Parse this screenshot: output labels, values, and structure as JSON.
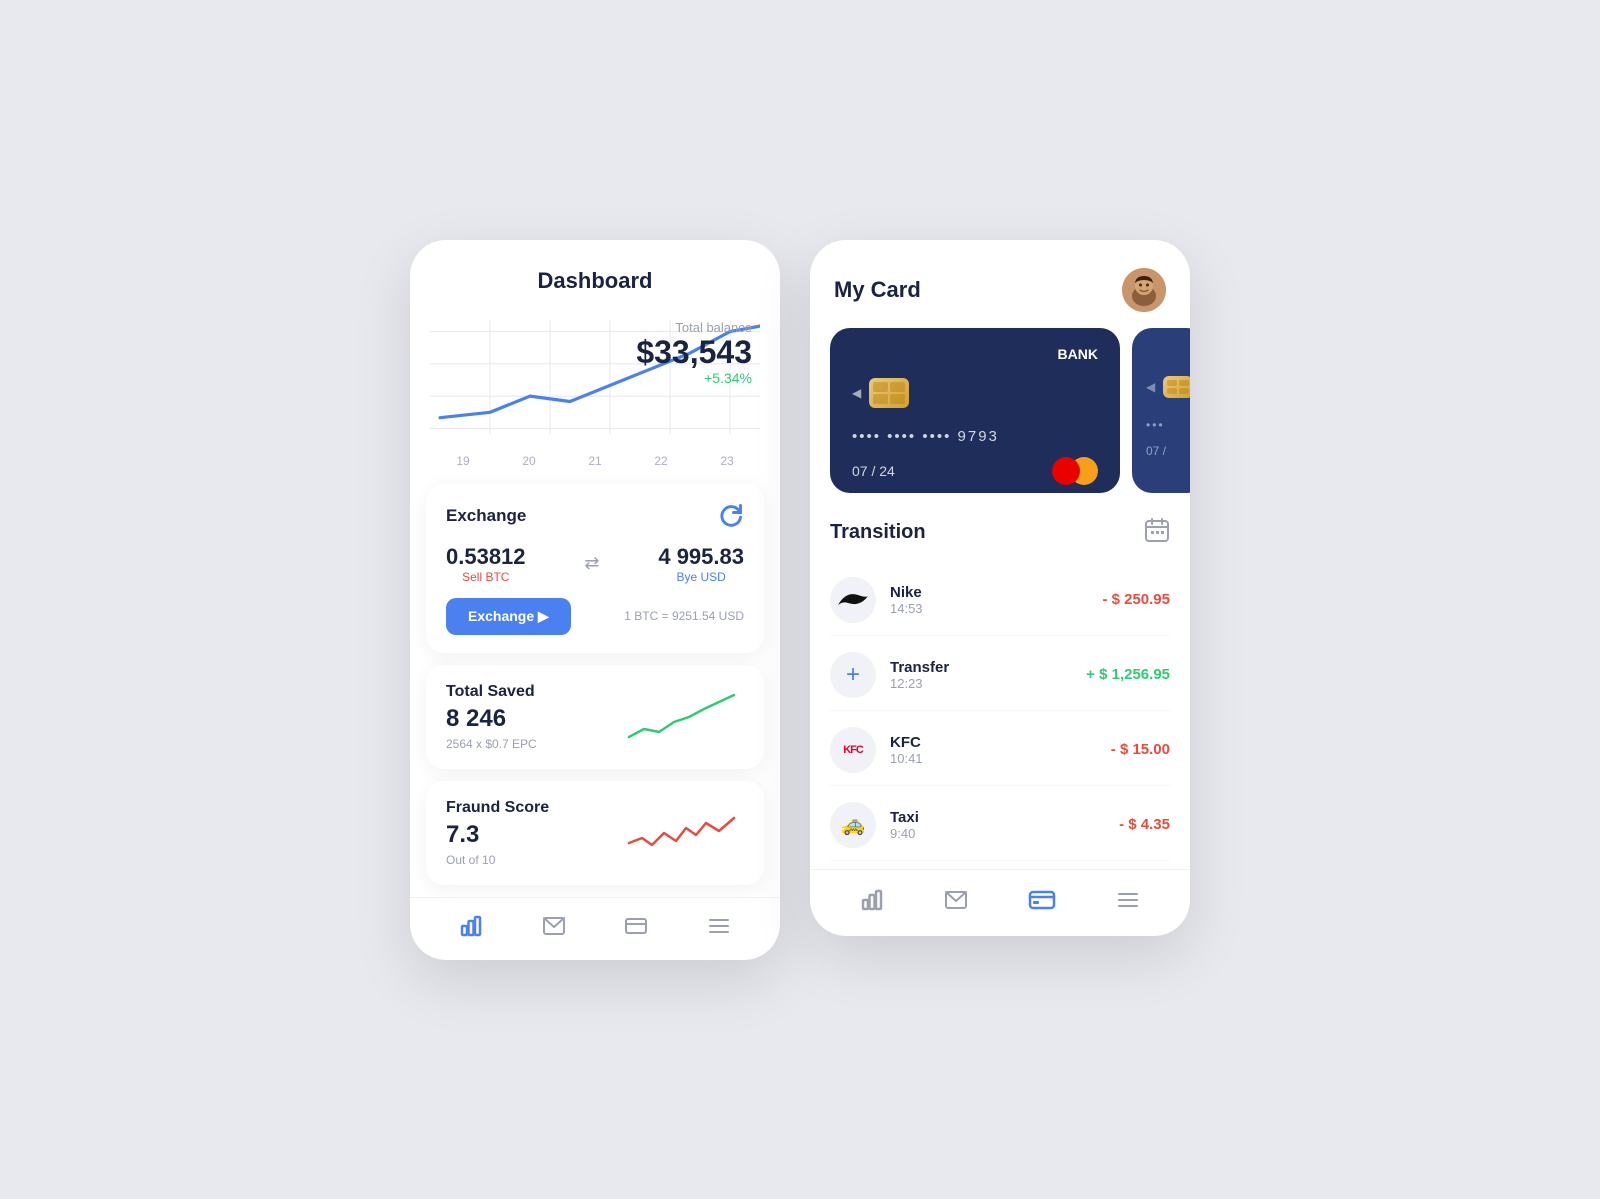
{
  "dashboard": {
    "title": "Dashboard",
    "balance": {
      "label": "Total balance",
      "value": "$33,543",
      "change": "+5.34%"
    },
    "chart_labels": [
      "19",
      "20",
      "21",
      "22",
      "23"
    ],
    "exchange": {
      "title": "Exchange",
      "sell_amount": "0.53812",
      "sell_label": "Sell BTC",
      "buy_amount": "4 995.83",
      "buy_label": "Bye USD",
      "button_label": "Exchange ▶",
      "rate": "1 BTC = 9251.54 USD"
    },
    "total_saved": {
      "title": "Total Saved",
      "value": "8 246",
      "sub": "2564 x $0.7 EPC"
    },
    "fraud": {
      "title": "Fraund Score",
      "value": "7.3",
      "sub": "Out of 10"
    },
    "nav": {
      "items": [
        "chart-bar-icon",
        "mail-icon",
        "card-icon",
        "menu-icon"
      ]
    }
  },
  "mycard": {
    "title": "My Card",
    "card": {
      "bank_name": "BANK",
      "number_dots": "•••• •••• ••••",
      "last_digits": "9793",
      "expiry": "07 / 24",
      "logo": "mastercard"
    },
    "transition_title": "Transition",
    "transactions": [
      {
        "name": "Nike",
        "time": "14:53",
        "amount": "- $ 250.95",
        "type": "negative",
        "logo": "nike"
      },
      {
        "name": "Transfer",
        "time": "12:23",
        "amount": "+ $ 1,256.95",
        "type": "positive",
        "logo": "transfer"
      },
      {
        "name": "KFC",
        "time": "10:41",
        "amount": "- $ 15.00",
        "type": "negative",
        "logo": "kfc"
      },
      {
        "name": "Taxi",
        "time": "9:40",
        "amount": "- $ 4.35",
        "type": "negative",
        "logo": "taxi"
      }
    ],
    "nav": {
      "active_index": 2,
      "items": [
        "chart-bar-icon",
        "mail-icon",
        "card-icon",
        "menu-icon"
      ]
    }
  }
}
